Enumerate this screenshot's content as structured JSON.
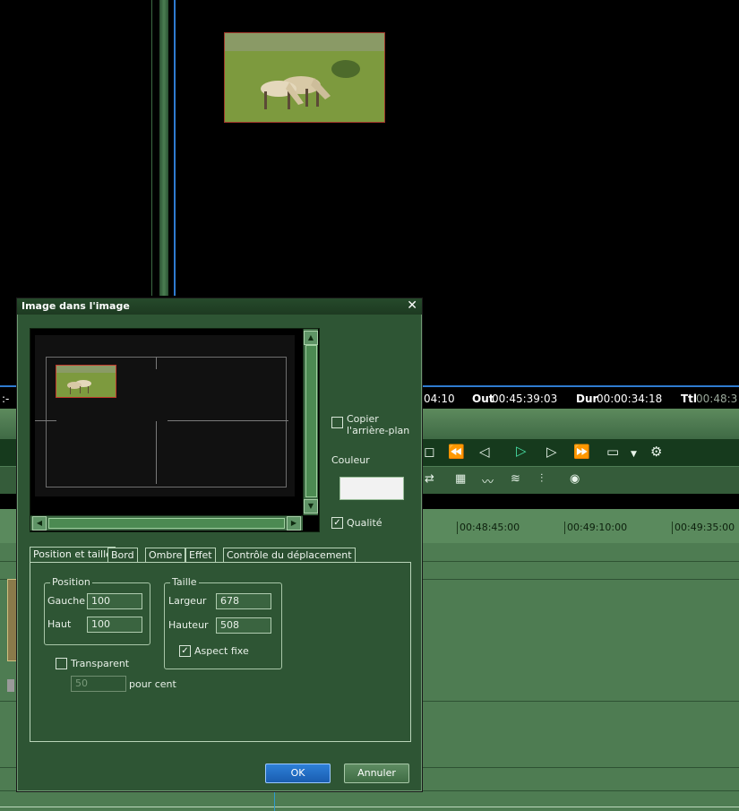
{
  "timecodes": {
    "in_partial": "04:10",
    "out_label": "Out",
    "out_value": "00:45:39:03",
    "dur_label": "Dur",
    "dur_value": "00:00:34:18",
    "ttl_label": "Ttl",
    "ttl_value": "00:48:3",
    "left_partial": ":-"
  },
  "ruler": {
    "ticks": [
      "00:48:45:00",
      "00:49:10:00",
      "00:49:35:00"
    ]
  },
  "dialog": {
    "title": "Image dans l'image",
    "close_glyph": "✕",
    "copy_background_line1": "Copier",
    "copy_background_line2": "l'arrière-plan",
    "copy_background_checked": false,
    "color_label": "Couleur",
    "color_value": "#f2f2f2",
    "quality_label": "Qualité",
    "quality_checked": true,
    "tabs": [
      {
        "label": "Position et taille",
        "active": true
      },
      {
        "label": "Bord",
        "active": false
      },
      {
        "label": "Ombre",
        "active": false
      },
      {
        "label": "Effet",
        "active": false
      },
      {
        "label": "Contrôle du déplacement",
        "active": false
      }
    ],
    "position": {
      "group_label": "Position",
      "left_label": "Gauche",
      "left_value": "100",
      "top_label": "Haut",
      "top_value": "100"
    },
    "size": {
      "group_label": "Taille",
      "width_label": "Largeur",
      "width_value": "678",
      "height_label": "Hauteur",
      "height_value": "508",
      "aspect_label": "Aspect fixe",
      "aspect_checked": true
    },
    "transparent": {
      "label": "Transparent",
      "checked": false,
      "value": "50",
      "unit": "pour cent"
    },
    "ok_label": "OK",
    "cancel_label": "Annuler"
  },
  "icons": {
    "transport": [
      "stop-icon",
      "rewind-icon",
      "prev-frame-icon",
      "play-icon",
      "next-frame-icon",
      "fast-forward-icon",
      "output-icon"
    ],
    "tools": [
      "swap-icon",
      "grid-icon",
      "audio-wave-icon",
      "audio-wave-small-icon",
      "mixer-icon",
      "color-wheel-icon"
    ]
  },
  "colors": {
    "dialog_bg": "#2e5534",
    "ok_button": "#1a5db0",
    "accent_blue": "#2f7bd0",
    "thumb_border": "#c0392b"
  }
}
